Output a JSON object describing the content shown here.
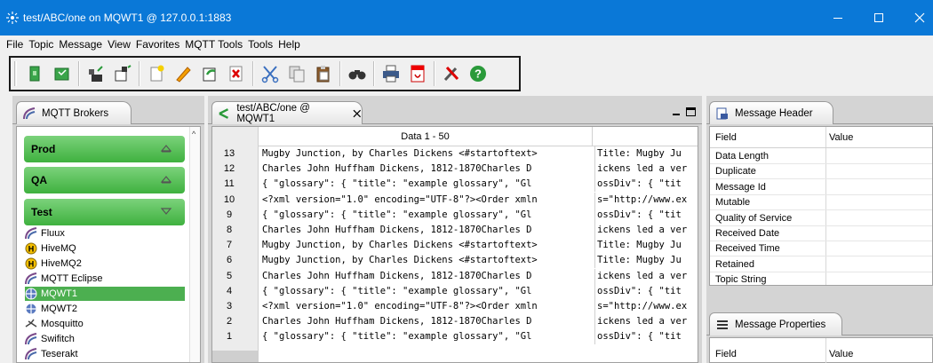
{
  "window": {
    "title": "test/ABC/one on MQWT1 @ 127.0.0.1:1883",
    "title_bar_color": "#0a78d7"
  },
  "menu": [
    "File",
    "Topic",
    "Message",
    "View",
    "Favorites",
    "MQTT Tools",
    "Tools",
    "Help"
  ],
  "toolbar": {
    "buttons": [
      "open-icon",
      "save-icon",
      "publish-icon",
      "subscribe-icon",
      "new-icon",
      "edit-icon",
      "redo-icon",
      "delete-icon",
      "cut-icon",
      "copy-icon",
      "paste-icon",
      "find-icon",
      "print-icon",
      "pdf-icon",
      "tools-icon",
      "help-icon"
    ]
  },
  "brokers_panel": {
    "tab_label": "MQTT Brokers",
    "groups": [
      {
        "label": "Prod",
        "expanded": false
      },
      {
        "label": "QA",
        "expanded": false
      },
      {
        "label": "Test",
        "expanded": true
      }
    ],
    "items": [
      {
        "label": "Fluux",
        "icon": "broker-icon"
      },
      {
        "label": "HiveMQ",
        "icon": "hivemq-icon"
      },
      {
        "label": "HiveMQ2",
        "icon": "hivemq-icon"
      },
      {
        "label": "MQTT Eclipse",
        "icon": "broker-icon"
      },
      {
        "label": "MQWT1",
        "icon": "mqwt-icon",
        "selected": true
      },
      {
        "label": "MQWT2",
        "icon": "mqwt-icon"
      },
      {
        "label": "Mosquitto",
        "icon": "mosquitto-icon"
      },
      {
        "label": "Swifitch",
        "icon": "broker-icon"
      },
      {
        "label": "Teserakt",
        "icon": "broker-icon"
      }
    ],
    "selected_color": "#4caf50"
  },
  "messages_panel": {
    "tab_label": "test/ABC/one @ MQWT1",
    "column_header": "Data 1 - 50",
    "rows": [
      {
        "num": "13",
        "c1": "Mugby Junction, by Charles Dickens <#startoftext>",
        "c2": "Title:  Mugby Ju"
      },
      {
        "num": "12",
        "c1": "Charles John Huffham Dickens, 1812-1870Charles D",
        "c2": "ickens led a ver"
      },
      {
        "num": "11",
        "c1": "{ \"glossary\": { \"title\":  \"example glossary\", \"Gl",
        "c2": "ossDiv\":  { \"tit"
      },
      {
        "num": "10",
        "c1": "<?xml version=\"1.0\" encoding=\"UTF-8\"?><Order xmln",
        "c2": "s=\"http://www.ex"
      },
      {
        "num": "9",
        "c1": "{ \"glossary\": { \"title\":  \"example glossary\", \"Gl",
        "c2": "ossDiv\":  { \"tit"
      },
      {
        "num": "8",
        "c1": "Charles John Huffham Dickens, 1812-1870Charles D",
        "c2": "ickens led a ver"
      },
      {
        "num": "7",
        "c1": "Mugby Junction, by Charles Dickens <#startoftext>",
        "c2": "Title:  Mugby Ju"
      },
      {
        "num": "6",
        "c1": "Mugby Junction, by Charles Dickens <#startoftext>",
        "c2": "Title:  Mugby Ju"
      },
      {
        "num": "5",
        "c1": "Charles John Huffham Dickens, 1812-1870Charles D",
        "c2": "ickens led a ver"
      },
      {
        "num": "4",
        "c1": "{ \"glossary\": { \"title\":  \"example glossary\", \"Gl",
        "c2": "ossDiv\":  { \"tit"
      },
      {
        "num": "3",
        "c1": "<?xml version=\"1.0\" encoding=\"UTF-8\"?><Order xmln",
        "c2": "s=\"http://www.ex"
      },
      {
        "num": "2",
        "c1": "Charles John Huffham Dickens, 1812-1870Charles D",
        "c2": "ickens led a ver"
      },
      {
        "num": "1",
        "c1": "{ \"glossary\": { \"title\":  \"example glossary\", \"Gl",
        "c2": "ossDiv\":  { \"tit"
      }
    ]
  },
  "header_panel": {
    "tab_label": "Message Header",
    "field_header": "Field",
    "value_header": "Value",
    "fields": [
      "Data Length",
      "Duplicate",
      "Message Id",
      "Mutable",
      "Quality of Service",
      "Received Date",
      "Received Time",
      "Retained",
      "Topic String"
    ]
  },
  "properties_panel": {
    "tab_label": "Message Properties",
    "field_header": "Field",
    "value_header": "Value"
  }
}
